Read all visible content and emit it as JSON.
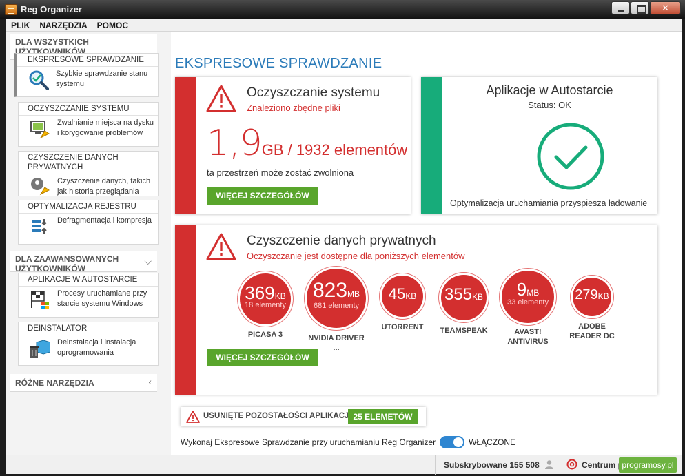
{
  "window": {
    "title": "Reg Organizer"
  },
  "menu": [
    "PLIK",
    "NARZĘDZIA",
    "POMOC"
  ],
  "sidebar": {
    "section_all": "DLA WSZYSTKICH UŻYTKOWNIKÓW",
    "items_all": [
      {
        "title": "EKSPRESOWE SPRAWDZANIE",
        "desc": "Szybkie sprawdzanie stanu systemu",
        "icon": "magnifier-check-icon"
      },
      {
        "title": "OCZYSZCZANIE SYSTEMU",
        "desc": "Zwalnianie miejsca na dysku i korygowanie problemów",
        "icon": "system-broom-icon"
      },
      {
        "title": "CZYSZCZENIE DANYCH PRYWATNYCH",
        "desc": "Czyszczenie danych, takich jak historia przeglądania",
        "icon": "privacy-broom-icon"
      },
      {
        "title": "OPTYMALIZACJA REJESTRU",
        "desc": "Defragmentacja i kompresja",
        "icon": "registry-compress-icon"
      }
    ],
    "section_adv": "DLA ZAAWANSOWANYCH UŻYTKOWNIKÓW",
    "items_adv": [
      {
        "title": "APLIKACJE W AUTOSTARCIE",
        "desc": "Procesy uruchamiane przy starcie systemu Windows",
        "icon": "startup-flag-icon"
      },
      {
        "title": "DEINSTALATOR",
        "desc": "Deinstalacja i instalacja oprogramowania",
        "icon": "uninstall-box-icon"
      }
    ],
    "section_misc": "RÓŻNE NARZĘDZIA"
  },
  "main": {
    "title": "EKSPRESOWE SPRAWDZANIE",
    "system_clean": {
      "title": "Oczyszczanie systemu",
      "subtitle": "Znaleziono zbędne pliki",
      "size_value": "1,9",
      "size_unit": "GB / 1932 elementów",
      "free_text": "ta przestrzeń może zostać zwolniona",
      "button": "WIĘCEJ SZCZEGÓŁÓW"
    },
    "autostart": {
      "title": "Aplikacje w Autostarcie",
      "status": "Status: OK",
      "footer": "Optymalizacja uruchamiania przyspiesza ładowanie"
    },
    "privacy": {
      "title": "Czyszczenie danych prywatnych",
      "subtitle": "Oczyszczanie jest dostępne dla poniższych elementów",
      "button": "WIĘCEJ SZCZEGÓŁÓW",
      "apps": [
        {
          "value": "369",
          "unit": "KB",
          "count": "18 elementy",
          "label": "PICASA 3"
        },
        {
          "value": "823",
          "unit": "MB",
          "count": "681 elementy",
          "label": "NVIDIA DRIVER ..."
        },
        {
          "value": "45",
          "unit": "KB",
          "count": "",
          "label": "UTORRENT"
        },
        {
          "value": "355",
          "unit": "KB",
          "count": "",
          "label": "TEAMSPEAK"
        },
        {
          "value": "9",
          "unit": "MB",
          "count": "33 elementy",
          "label": "AVAST! ANTIVIRUS"
        },
        {
          "value": "279",
          "unit": "KB",
          "count": "",
          "label": "ADOBE READER DC"
        }
      ]
    },
    "leftovers": {
      "label": "USUNIĘTE POZOSTAŁOŚCI APLIKACJI",
      "badge": "25 ELEMETÓW"
    },
    "autorun": {
      "label": "Wykonaj Ekspresowe Sprawdzanie przy uruchamianiu Reg Organizer",
      "state": "WŁĄCZONE"
    }
  },
  "statusbar": {
    "subscribers": "Subskrybowane 155 508",
    "center": "Centrum p"
  },
  "watermark": "programosy.pl",
  "colors": {
    "accent_blue": "#2b7bb9",
    "alert_red": "#d32f2f",
    "ok_green": "#17ac7a",
    "button_green": "#59a52c"
  }
}
